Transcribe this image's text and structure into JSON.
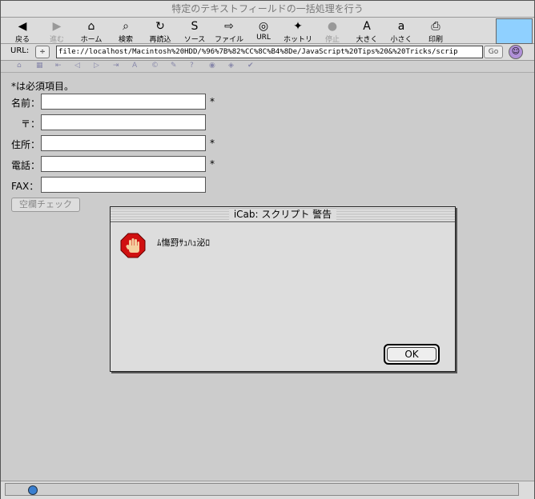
{
  "window": {
    "title": "特定のテキストフィールドの一括処理を行う"
  },
  "toolbar": {
    "items": [
      {
        "label": "戻る",
        "icon": "back-arrow-icon",
        "glyph": "◀",
        "enabled": true
      },
      {
        "label": "進む",
        "icon": "forward-arrow-icon",
        "glyph": "▶",
        "enabled": false
      },
      {
        "label": "ホーム",
        "icon": "home-icon",
        "glyph": "⌂",
        "enabled": true
      },
      {
        "label": "検索",
        "icon": "search-icon",
        "glyph": "⌕",
        "enabled": true
      },
      {
        "label": "再読込",
        "icon": "reload-icon",
        "glyph": "↻",
        "enabled": true
      },
      {
        "label": "ソース",
        "icon": "source-icon",
        "glyph": "S",
        "enabled": true
      },
      {
        "label": "ファイル",
        "icon": "file-icon",
        "glyph": "⇨",
        "enabled": true
      },
      {
        "label": "URL",
        "icon": "url-icon",
        "glyph": "◎",
        "enabled": true
      },
      {
        "label": "ホットリスト",
        "icon": "hotlist-icon",
        "glyph": "✦",
        "enabled": true
      },
      {
        "label": "停止",
        "icon": "stop-icon",
        "glyph": "●",
        "enabled": false
      },
      {
        "label": "大きく",
        "icon": "font-larger-icon",
        "glyph": "A",
        "enabled": true
      },
      {
        "label": "小さく",
        "icon": "font-smaller-icon",
        "glyph": "a",
        "enabled": true
      },
      {
        "label": "印刷",
        "icon": "print-icon",
        "glyph": "⎙",
        "enabled": true
      }
    ]
  },
  "urlbar": {
    "label": "URL:",
    "value": "file://localhost/Macintosh%20HDD/%96%7B%82%CC%8C%B4%8De/JavaScript%20Tips%20&%20Tricks/scrip",
    "go_label": "Go",
    "spin_glyph": "÷"
  },
  "navstrip": {
    "icons": [
      {
        "glyph": "⌂",
        "name": "nav-home-icon"
      },
      {
        "glyph": "▦",
        "name": "nav-grid-icon"
      },
      {
        "glyph": "⇤",
        "name": "nav-first-icon"
      },
      {
        "glyph": "◁",
        "name": "nav-prev-icon"
      },
      {
        "glyph": "▷",
        "name": "nav-next-icon"
      },
      {
        "glyph": "⇥",
        "name": "nav-last-icon"
      },
      {
        "glyph": "A",
        "name": "nav-author-icon"
      },
      {
        "glyph": "©",
        "name": "nav-copyright-icon"
      },
      {
        "glyph": "✎",
        "name": "nav-edit-icon"
      },
      {
        "glyph": "?",
        "name": "nav-help-icon"
      },
      {
        "glyph": "◉",
        "name": "nav-target-icon"
      },
      {
        "glyph": "◈",
        "name": "nav-diamond-icon"
      },
      {
        "glyph": "✔",
        "name": "nav-check-icon"
      }
    ]
  },
  "form": {
    "note": "*は必須項目。",
    "fields": [
      {
        "label": "名前：",
        "required": "*"
      },
      {
        "label": "〒：",
        "required": ""
      },
      {
        "label": "住所：",
        "required": "*"
      },
      {
        "label": "電話：",
        "required": "*"
      },
      {
        "label": "FAX：",
        "required": ""
      }
    ],
    "check_button": "空欄チェック"
  },
  "dialog": {
    "title": "iCab: スクリプト 警告",
    "message": "ﾑ慯罸ｻｭﾊｭ泌ﾛ",
    "ok_label": "OK",
    "icon": "stop-hand-icon"
  },
  "statusbar": {
    "icon": "globe-icon"
  }
}
